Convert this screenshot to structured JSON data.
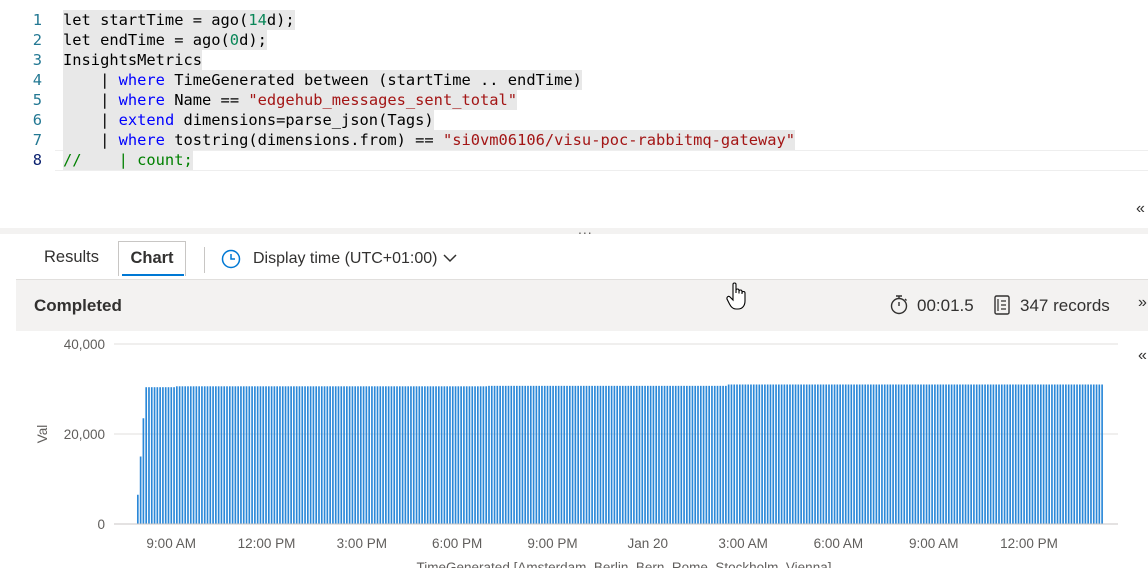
{
  "editor": {
    "lines": [
      {
        "num": "1",
        "tokens": [
          {
            "t": "let startTime = ago(",
            "c": ""
          },
          {
            "t": "14",
            "c": "num"
          },
          {
            "t": "d);",
            "c": ""
          }
        ]
      },
      {
        "num": "2",
        "tokens": [
          {
            "t": "let endTime = ago(",
            "c": ""
          },
          {
            "t": "0",
            "c": "num"
          },
          {
            "t": "d);",
            "c": ""
          }
        ]
      },
      {
        "num": "3",
        "tokens": [
          {
            "t": "InsightsMetrics",
            "c": ""
          }
        ]
      },
      {
        "num": "4",
        "tokens": [
          {
            "t": "    | ",
            "c": ""
          },
          {
            "t": "where",
            "c": "kw"
          },
          {
            "t": " TimeGenerated between (startTime .. endTime)",
            "c": ""
          }
        ]
      },
      {
        "num": "5",
        "tokens": [
          {
            "t": "    | ",
            "c": ""
          },
          {
            "t": "where",
            "c": "kw"
          },
          {
            "t": " Name == ",
            "c": ""
          },
          {
            "t": "\"edgehub_messages_sent_total\"",
            "c": "str"
          }
        ]
      },
      {
        "num": "6",
        "tokens": [
          {
            "t": "    | ",
            "c": ""
          },
          {
            "t": "extend",
            "c": "kw"
          },
          {
            "t": " dimensions=parse_json(Tags)",
            "c": ""
          }
        ]
      },
      {
        "num": "7",
        "tokens": [
          {
            "t": "    | ",
            "c": ""
          },
          {
            "t": "where",
            "c": "kw"
          },
          {
            "t": " tostring(dimensions.from) == ",
            "c": ""
          },
          {
            "t": "\"si0vm06106/visu-poc-rabbitmq-gateway\"",
            "c": "str"
          }
        ]
      },
      {
        "num": "8",
        "tokens": [
          {
            "t": "//    | count;",
            "c": "cmt"
          }
        ]
      }
    ],
    "grip": "...",
    "collapse_glyph": "«"
  },
  "tabs": {
    "results": "Results",
    "chart": "Chart"
  },
  "time_display": {
    "label": "Display time (UTC+01:00)",
    "icon": "clock-icon"
  },
  "status": {
    "text": "Completed",
    "elapsed": "00:01.5",
    "records": "347 records",
    "more_glyph": "»",
    "side_glyph": "«"
  },
  "colors": {
    "bar": "#2b88d8",
    "grid": "#e1dfdd",
    "accent": "#0078d4"
  },
  "chart_data": {
    "type": "bar",
    "xlabel": "TimeGenerated [Amsterdam, Berlin, Bern, Rome, Stockholm, Vienna]",
    "ylabel": "Val",
    "ylim": [
      0,
      40000
    ],
    "y_ticks": [
      {
        "value": 0,
        "label": "0"
      },
      {
        "value": 20000,
        "label": "20,000"
      },
      {
        "value": 40000,
        "label": "40,000"
      }
    ],
    "x_ticks": [
      {
        "hour": 9,
        "label": "9:00 AM"
      },
      {
        "hour": 12,
        "label": "12:00 PM"
      },
      {
        "hour": 15,
        "label": "3:00 PM"
      },
      {
        "hour": 18,
        "label": "6:00 PM"
      },
      {
        "hour": 21,
        "label": "9:00 PM"
      },
      {
        "hour": 24,
        "label": "Jan 20"
      },
      {
        "hour": 27,
        "label": "3:00 AM"
      },
      {
        "hour": 30,
        "label": "6:00 AM"
      },
      {
        "hour": 33,
        "label": "9:00 AM"
      },
      {
        "hour": 36,
        "label": "12:00 PM"
      }
    ],
    "x_range_hours": [
      7.2,
      38.8
    ],
    "series": [
      {
        "start_hour": 7.95,
        "end_hour": 38.3,
        "count": 347,
        "leading_values": [
          6500,
          15000,
          23500
        ],
        "levels": [
          {
            "from_hour": 8.1,
            "value": 30400
          },
          {
            "from_hour": 9.1,
            "value": 30600
          },
          {
            "from_hour": 19.0,
            "value": 30700
          },
          {
            "from_hour": 26.5,
            "value": 31000
          }
        ]
      }
    ]
  }
}
